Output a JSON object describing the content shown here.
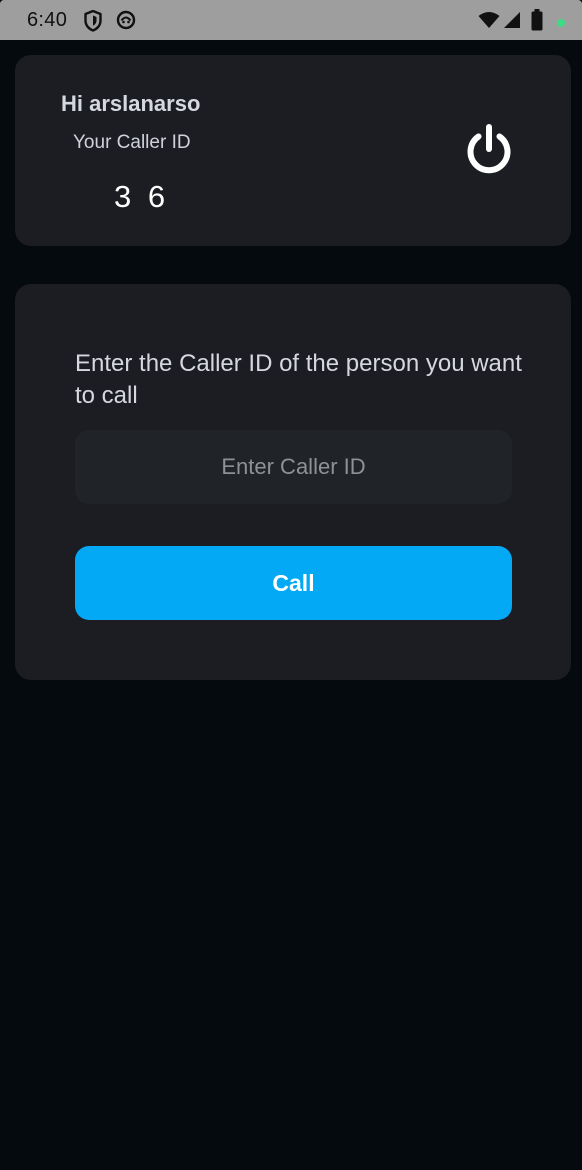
{
  "status_bar": {
    "time": "6:40",
    "icons": [
      "shield-icon",
      "app-notification-icon",
      "wifi-icon",
      "signal-icon",
      "battery-icon",
      "privacy-dot-icon"
    ],
    "privacy_dot_color": "#3ddc84"
  },
  "profile_card": {
    "greeting": "Hi arslanarso",
    "caller_id_label": "Your Caller ID",
    "caller_id_value": "3 6",
    "power_icon": "power-icon"
  },
  "call_card": {
    "prompt": "Enter the Caller ID of the person you want to call",
    "input_placeholder": "Enter Caller ID",
    "input_value": "",
    "call_button_label": "Call"
  },
  "colors": {
    "background": "#050a0f",
    "card": "#1b1d22",
    "input": "#202327",
    "accent": "#03a9f4"
  }
}
